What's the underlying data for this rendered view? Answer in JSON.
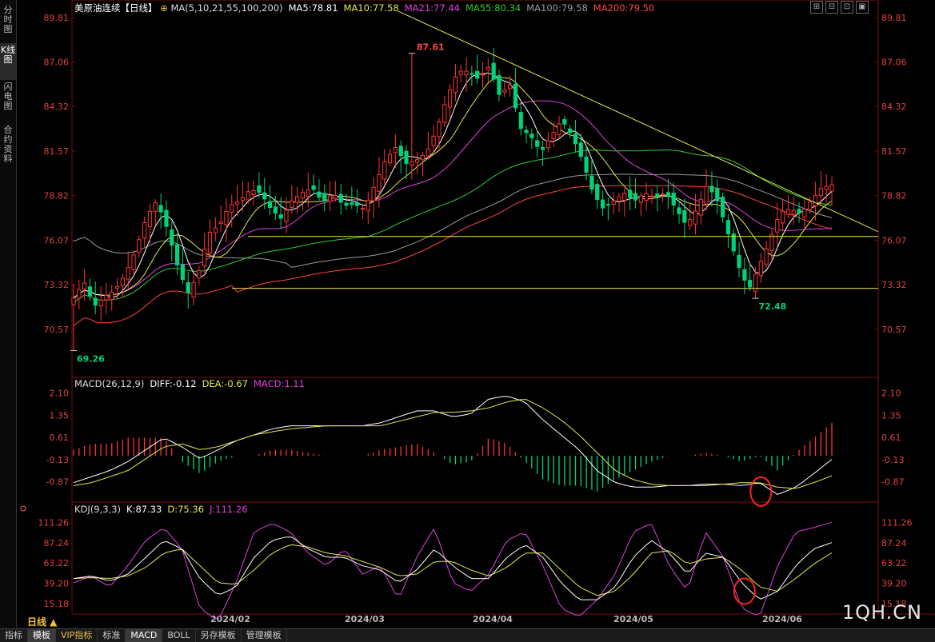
{
  "left_tabs": [
    {
      "label": "分时图",
      "active": false
    },
    {
      "label": "K线图",
      "active": true
    },
    {
      "label": "闪电图",
      "active": false
    },
    {
      "label": "合约资料",
      "active": false
    }
  ],
  "toolbar": [
    "指标",
    "模板",
    "VIP指标",
    "标准",
    "MACD",
    "BOLL",
    "另存模板",
    "管理模板"
  ],
  "period_label": "日线 ▲",
  "watermark": "1QH.CN",
  "colors": {
    "up": "#ff3333",
    "down": "#00d27a",
    "ma5": "#ffffff",
    "ma10": "#e6e64c",
    "ma21": "#e040e0",
    "ma55": "#33cc33",
    "ma100": "#9a9a9a",
    "ma200": "#ff4444",
    "trend": "#e6e64c"
  },
  "chart_data": [
    {
      "type": "candlestick",
      "title": "美原油连续【日线】",
      "legend": [
        {
          "text": "MA(5,10,21,55,100,200)",
          "color": "#dddddd"
        },
        {
          "text": "MA5:78.81",
          "color": "#ffffff"
        },
        {
          "text": "MA10:77.58",
          "color": "#e6e64c"
        },
        {
          "text": "MA21:77.44",
          "color": "#e040e0"
        },
        {
          "text": "MA55:80.34",
          "color": "#33cc33"
        },
        {
          "text": "MA100:79.58",
          "color": "#9a9a9a"
        },
        {
          "text": "MA200:79.50",
          "color": "#ff4444"
        }
      ],
      "y_ticks": [
        "89.81",
        "87.06",
        "84.32",
        "81.57",
        "78.82",
        "76.07",
        "73.32",
        "70.57"
      ],
      "ylim": [
        68.0,
        90.5
      ],
      "x_ticks": [
        "2024/02",
        "2024/03",
        "2024/04",
        "2024/05",
        "2024/06"
      ],
      "annotations": [
        {
          "text": "87.61",
          "value": 87.61,
          "kind": "high"
        },
        {
          "text": "72.48",
          "value": 72.48,
          "kind": "low"
        },
        {
          "text": "69.26",
          "value": 69.26,
          "kind": "low"
        }
      ],
      "horizontal_levels": [
        76.3,
        73.1
      ],
      "trendline": {
        "from": 90.2,
        "to": 76.6
      },
      "close_anchors": [
        72.5,
        73.5,
        72.0,
        72.6,
        73.0,
        74.0,
        75.5,
        77.5,
        78.5,
        76.8,
        74.5,
        72.8,
        74.0,
        76.5,
        77.0,
        78.2,
        78.5,
        79.2,
        79.0,
        78.0,
        77.4,
        78.5,
        79.0,
        79.3,
        78.4,
        79.0,
        78.2,
        78.3,
        78.0,
        79.5,
        81.0,
        81.8,
        80.8,
        81.0,
        81.5,
        83.0,
        85.0,
        86.5,
        86.5,
        86.0,
        86.8,
        85.0,
        85.7,
        83.0,
        82.5,
        81.5,
        82.5,
        83.5,
        82.5,
        81.0,
        79.0,
        78.0,
        78.5,
        79.0,
        78.5,
        79.0,
        78.7,
        79.0,
        78.0,
        77.0,
        78.0,
        79.5,
        78.5,
        76.5,
        74.5,
        73.0,
        74.5,
        76.0,
        77.8,
        78.0,
        77.7,
        78.5,
        79.3,
        79.5
      ]
    },
    {
      "type": "line",
      "title": "MACD(26,12,9)",
      "legend": [
        {
          "text": "MACD(26,12,9)",
          "color": "#dddddd"
        },
        {
          "text": "DIFF:-0.12",
          "color": "#ffffff"
        },
        {
          "text": "DEA:-0.67",
          "color": "#e6e64c"
        },
        {
          "text": "MACD:1.11",
          "color": "#e040e0"
        }
      ],
      "y_ticks": [
        "2.10",
        "1.35",
        "0.61",
        "-0.13",
        "-0.87"
      ],
      "ylim": [
        -1.55,
        2.3
      ],
      "diff_anchors": [
        -0.9,
        -0.7,
        -0.5,
        -0.2,
        0.2,
        0.6,
        0.3,
        -0.1,
        0.2,
        0.5,
        0.7,
        0.9,
        1.0,
        1.0,
        1.0,
        1.0,
        1.0,
        1.1,
        1.3,
        1.5,
        1.5,
        1.3,
        1.4,
        1.9,
        2.0,
        1.8,
        1.2,
        0.7,
        0.2,
        -0.5,
        -0.9,
        -1.05,
        -1.05,
        -1.0,
        -1.0,
        -0.95,
        -0.95,
        -1.0,
        -0.9,
        -1.3,
        -1.05,
        -0.6,
        -0.12
      ],
      "dea_anchors": [
        -1.0,
        -0.9,
        -0.7,
        -0.5,
        -0.1,
        0.3,
        0.4,
        0.2,
        0.3,
        0.5,
        0.7,
        0.8,
        0.9,
        0.95,
        1.0,
        1.0,
        1.0,
        1.0,
        1.15,
        1.3,
        1.45,
        1.45,
        1.5,
        1.6,
        1.8,
        1.9,
        1.6,
        1.2,
        0.7,
        0.1,
        -0.5,
        -0.8,
        -0.95,
        -1.0,
        -1.0,
        -1.0,
        -0.95,
        -0.9,
        -0.9,
        -1.05,
        -1.1,
        -0.9,
        -0.67
      ],
      "highlight": "circle at latest DIFF/DEA crossover"
    },
    {
      "type": "line",
      "title": "KDJ(9,3,3)",
      "legend": [
        {
          "text": "KDJ(9,3,3)",
          "color": "#dddddd"
        },
        {
          "text": "K:87.33",
          "color": "#ffffff"
        },
        {
          "text": "D:75.36",
          "color": "#e6e64c"
        },
        {
          "text": "J:111.26",
          "color": "#e040e0"
        }
      ],
      "y_ticks": [
        "111.26",
        "87.24",
        "63.22",
        "39.20",
        "15.18"
      ],
      "ylim": [
        5,
        120
      ],
      "j_anchors": [
        40,
        48,
        35,
        60,
        90,
        105,
        80,
        10,
        -5,
        40,
        100,
        110,
        100,
        75,
        60,
        80,
        50,
        60,
        20,
        70,
        105,
        40,
        30,
        50,
        90,
        100,
        60,
        10,
        0,
        20,
        50,
        100,
        110,
        60,
        30,
        100,
        70,
        10,
        0,
        60,
        100,
        105,
        111.26
      ],
      "k_anchors": [
        45,
        48,
        42,
        50,
        70,
        90,
        80,
        45,
        25,
        35,
        70,
        90,
        95,
        80,
        70,
        70,
        60,
        55,
        40,
        55,
        80,
        60,
        45,
        45,
        70,
        85,
        70,
        40,
        20,
        20,
        35,
        70,
        90,
        75,
        50,
        75,
        70,
        40,
        20,
        30,
        60,
        80,
        87.33
      ],
      "d_anchors": [
        45,
        46,
        45,
        48,
        58,
        75,
        80,
        60,
        40,
        38,
        55,
        75,
        85,
        82,
        75,
        72,
        65,
        58,
        48,
        50,
        65,
        65,
        55,
        48,
        58,
        75,
        75,
        55,
        35,
        25,
        30,
        50,
        75,
        78,
        62,
        68,
        70,
        55,
        35,
        30,
        45,
        62,
        75.36
      ],
      "highlight": "circle at latest K/D crossover"
    }
  ]
}
